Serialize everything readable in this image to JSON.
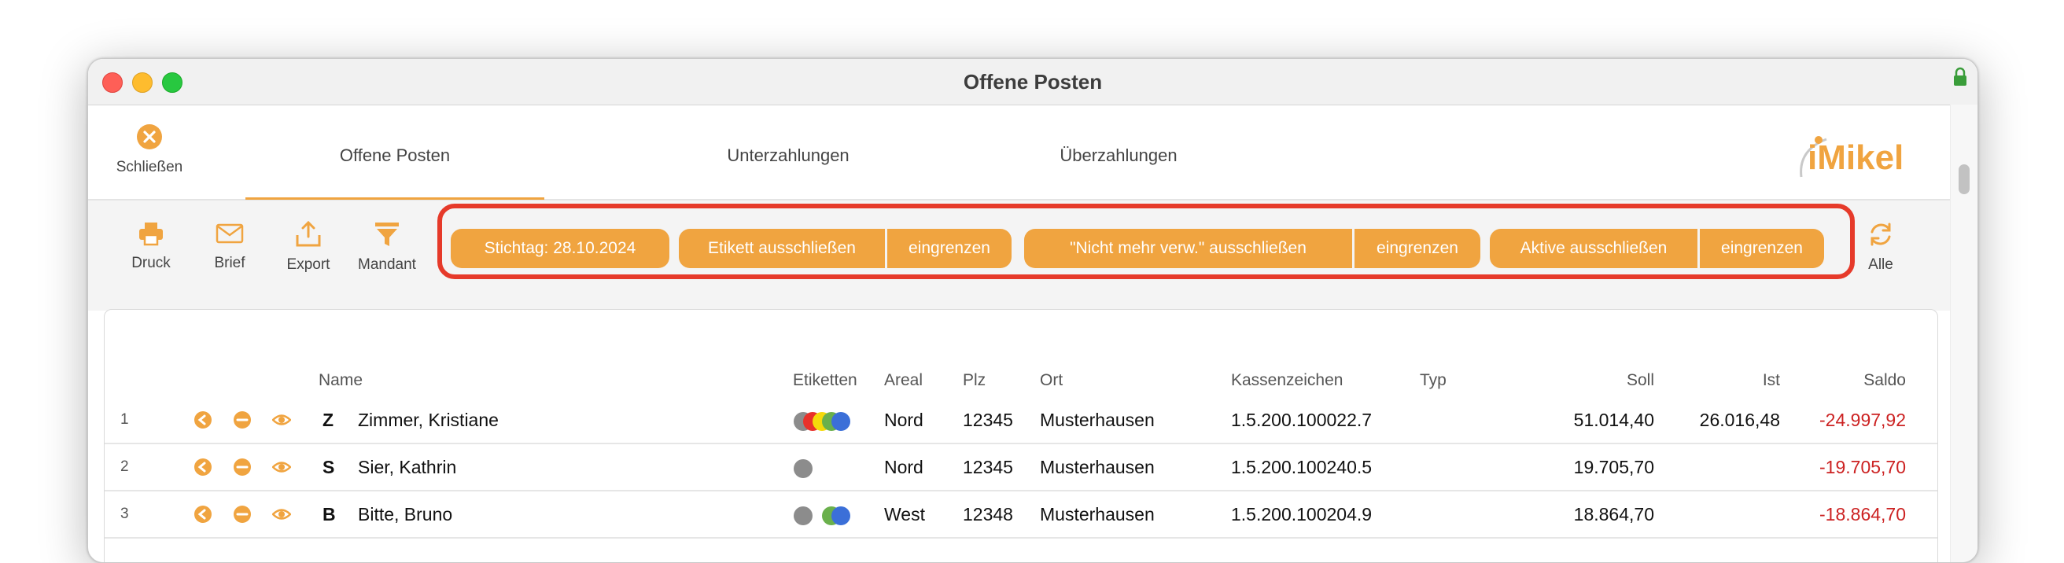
{
  "window": {
    "title": "Offene Posten"
  },
  "close_label": "Schließen",
  "tabs": [
    {
      "label": "Offene Posten"
    },
    {
      "label": "Unterzahlungen"
    },
    {
      "label": "Überzahlungen"
    }
  ],
  "logo_text": "iMikel",
  "toolbar": {
    "druck": "Druck",
    "brief": "Brief",
    "export": "Export",
    "mandant": "Mandant",
    "alle": "Alle"
  },
  "filters": {
    "stichtag": "Stichtag: 28.10.2024",
    "etikett_exclude": "Etikett ausschließen",
    "etikett_limit": "eingrenzen",
    "nmv_exclude": "\"Nicht mehr verw.\" ausschließen",
    "nmv_limit": "eingrenzen",
    "aktive_exclude": "Aktive ausschließen",
    "aktive_limit": "eingrenzen"
  },
  "columns": {
    "name": "Name",
    "etiketten": "Etiketten",
    "areal": "Areal",
    "plz": "Plz",
    "ort": "Ort",
    "kassenzeichen": "Kassenzeichen",
    "typ": "Typ",
    "soll": "Soll",
    "ist": "Ist",
    "saldo": "Saldo"
  },
  "rows": [
    {
      "index": "1",
      "letter": "Z",
      "name": "Zimmer, Kristiane",
      "areal": "Nord",
      "plz": "12345",
      "ort": "Musterhausen",
      "kassenzeichen": "1.5.200.100022.7",
      "typ": "",
      "soll": "51.014,40",
      "ist": "26.016,48",
      "saldo": "-24.997,92"
    },
    {
      "index": "2",
      "letter": "S",
      "name": "Sier, Kathrin",
      "areal": "Nord",
      "plz": "12345",
      "ort": "Musterhausen",
      "kassenzeichen": "1.5.200.100240.5",
      "typ": "",
      "soll": "19.705,70",
      "ist": "",
      "saldo": "-19.705,70"
    },
    {
      "index": "3",
      "letter": "B",
      "name": "Bitte, Bruno",
      "areal": "West",
      "plz": "12348",
      "ort": "Musterhausen",
      "kassenzeichen": "1.5.200.100204.9",
      "typ": "",
      "soll": "18.864,70",
      "ist": "",
      "saldo": "-18.864,70"
    }
  ],
  "colors": {
    "accent": "#f0a440",
    "highlight": "#e63a2a",
    "negative": "#cc2222",
    "label_gray": "#8c8c8c",
    "label_red": "#e8312a",
    "label_yellow": "#f5d90a",
    "label_green": "#6ab04c",
    "label_blue": "#3b6fd8"
  }
}
